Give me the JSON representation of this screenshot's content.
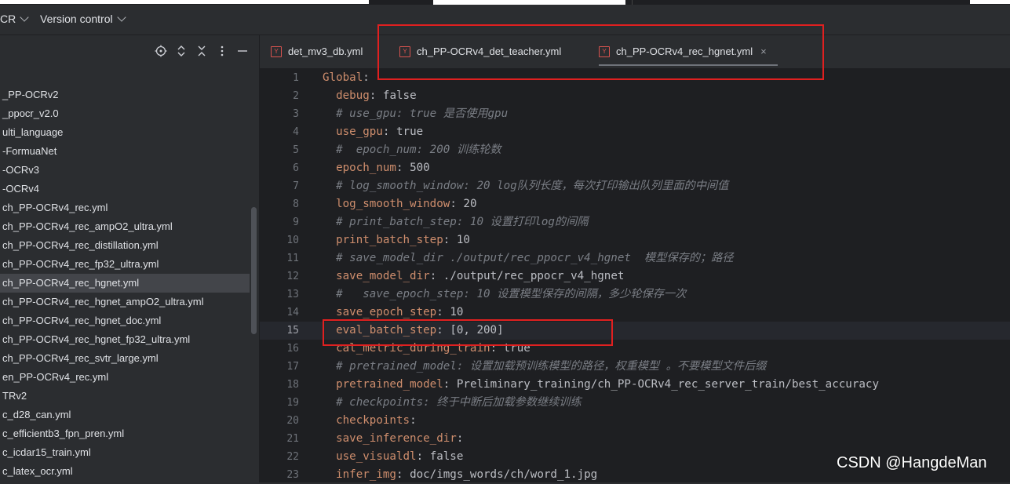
{
  "titlebar": {
    "project_menu": "CR",
    "vcs_menu": "Version control"
  },
  "project_panel": {
    "toolbar_icons": [
      "target-icon",
      "expand-collapse-icon",
      "collapse-all-icon",
      "more-icon",
      "minimize-icon"
    ],
    "items": [
      {
        "label": "_PP-OCRv2"
      },
      {
        "label": "_ppocr_v2.0"
      },
      {
        "label": "ulti_language"
      },
      {
        "label": "-FormuaNet"
      },
      {
        "label": "-OCRv3"
      },
      {
        "label": "-OCRv4"
      },
      {
        "label": "ch_PP-OCRv4_rec.yml"
      },
      {
        "label": "ch_PP-OCRv4_rec_ampO2_ultra.yml"
      },
      {
        "label": "ch_PP-OCRv4_rec_distillation.yml"
      },
      {
        "label": "ch_PP-OCRv4_rec_fp32_ultra.yml"
      },
      {
        "label": "ch_PP-OCRv4_rec_hgnet.yml",
        "selected": true
      },
      {
        "label": "ch_PP-OCRv4_rec_hgnet_ampO2_ultra.yml"
      },
      {
        "label": "ch_PP-OCRv4_rec_hgnet_doc.yml"
      },
      {
        "label": "ch_PP-OCRv4_rec_hgnet_fp32_ultra.yml"
      },
      {
        "label": "ch_PP-OCRv4_rec_svtr_large.yml"
      },
      {
        "label": "en_PP-OCRv4_rec.yml"
      },
      {
        "label": "TRv2"
      },
      {
        "label": "c_d28_can.yml"
      },
      {
        "label": "c_efficientb3_fpn_pren.yml"
      },
      {
        "label": "c_icdar15_train.yml"
      },
      {
        "label": "c_latex_ocr.yml"
      }
    ]
  },
  "tabs": [
    {
      "label": "det_mv3_db.yml",
      "icon": "yaml-file-icon",
      "active": false
    },
    {
      "label": "ch_PP-OCRv4_det_teacher.yml",
      "icon": "yaml-file-icon",
      "active": false
    },
    {
      "label": "ch_PP-OCRv4_rec_hgnet.yml",
      "icon": "yaml-file-icon",
      "active": true,
      "close": "×"
    }
  ],
  "editor": {
    "current_line": 15,
    "lines": [
      {
        "n": "1",
        "key": "Global",
        "sep": ":",
        "val": "",
        "comment": "",
        "indent": ""
      },
      {
        "n": "2",
        "key": "debug",
        "sep": ": ",
        "val": "false",
        "comment": "",
        "indent": "  "
      },
      {
        "n": "3",
        "key": "",
        "sep": "",
        "val": "",
        "comment": "# use_gpu: true 是否使用gpu",
        "indent": "  "
      },
      {
        "n": "4",
        "key": "use_gpu",
        "sep": ": ",
        "val": "true",
        "comment": "",
        "indent": "  "
      },
      {
        "n": "5",
        "key": "",
        "sep": "",
        "val": "",
        "comment": "#  epoch_num: 200 训练轮数",
        "indent": "  "
      },
      {
        "n": "6",
        "key": "epoch_num",
        "sep": ": ",
        "val": "500",
        "comment": "",
        "indent": "  "
      },
      {
        "n": "7",
        "key": "",
        "sep": "",
        "val": "",
        "comment": "# log_smooth_window: 20 log队列长度，每次打印输出队列里面的中间值",
        "indent": "  "
      },
      {
        "n": "8",
        "key": "log_smooth_window",
        "sep": ": ",
        "val": "20",
        "comment": "",
        "indent": "  "
      },
      {
        "n": "9",
        "key": "",
        "sep": "",
        "val": "",
        "comment": "# print_batch_step: 10 设置打印log的间隔",
        "indent": "  "
      },
      {
        "n": "10",
        "key": "print_batch_step",
        "sep": ": ",
        "val": "10",
        "comment": "",
        "indent": "  "
      },
      {
        "n": "11",
        "key": "",
        "sep": "",
        "val": "",
        "comment": "# save_model_dir ./output/rec_ppocr_v4_hgnet  模型保存的；路径",
        "indent": "  "
      },
      {
        "n": "12",
        "key": "save_model_dir",
        "sep": ": ",
        "val": "./output/rec_ppocr_v4_hgnet",
        "comment": "",
        "indent": "  "
      },
      {
        "n": "13",
        "key": "",
        "sep": "",
        "val": "",
        "comment": "#   save_epoch_step: 10 设置模型保存的间隔，多少轮保存一次",
        "indent": "  "
      },
      {
        "n": "14",
        "key": "save_epoch_step",
        "sep": ": ",
        "val": "10",
        "comment": "",
        "indent": "  "
      },
      {
        "n": "15",
        "key": "eval_batch_step",
        "sep": ": ",
        "val": "[0, 200]",
        "comment": "",
        "indent": "  "
      },
      {
        "n": "16",
        "key": "cal_metric_during_train",
        "sep": ": ",
        "val": "true",
        "comment": "",
        "indent": "  "
      },
      {
        "n": "17",
        "key": "",
        "sep": "",
        "val": "",
        "comment": "# pretrained_model: 设置加载预训练模型的路径，权重模型 。不要模型文件后缀",
        "indent": "  "
      },
      {
        "n": "18",
        "key": "pretrained_model",
        "sep": ": ",
        "val": "Preliminary_training/ch_PP-OCRv4_rec_server_train/best_accuracy",
        "comment": "",
        "indent": "  "
      },
      {
        "n": "19",
        "key": "",
        "sep": "",
        "val": "",
        "comment": "# checkpoints: 终于中断后加载参数继续训练",
        "indent": "  "
      },
      {
        "n": "20",
        "key": "checkpoints",
        "sep": ":",
        "val": "",
        "comment": "",
        "indent": "  "
      },
      {
        "n": "21",
        "key": "save_inference_dir",
        "sep": ":",
        "val": "",
        "comment": "",
        "indent": "  "
      },
      {
        "n": "22",
        "key": "use_visualdl",
        "sep": ": ",
        "val": "false",
        "comment": "",
        "indent": "  "
      },
      {
        "n": "23",
        "key": "infer_img",
        "sep": ": ",
        "val": "doc/imgs_words/ch/word_1.jpg",
        "comment": "",
        "indent": "  "
      }
    ]
  },
  "watermark": "CSDN @HangdeMan",
  "colors": {
    "key": "#cf8e6d",
    "value": "#bcbec4",
    "comment": "#7a7e85",
    "annotation": "#e02020"
  }
}
